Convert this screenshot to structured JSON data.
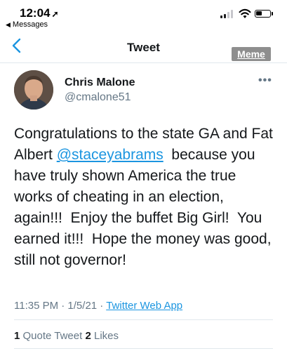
{
  "status_bar": {
    "time": "12:04",
    "back_app": "Messages"
  },
  "nav": {
    "title": "Tweet",
    "badge": "Meme"
  },
  "tweet": {
    "author_name": "Chris Malone",
    "author_handle": "@cmalone51",
    "text_before": "Congratulations to the state GA and Fat Albert ",
    "mention": "@staceyabrams",
    "text_after": "  because you have truly shown America the true works of cheating in an election, again!!!  Enjoy the buffet Big Girl!  You earned it!!!  Hope the money was good, still not governor!",
    "timestamp": "11:35 PM · 1/5/21 · ",
    "source": "Twitter Web App"
  },
  "stats": {
    "quote_count": "1",
    "quote_label": " Quote Tweet ",
    "like_count": "2",
    "like_label": " Likes"
  },
  "colors": {
    "link": "#1b95e0",
    "secondary_text": "#657786",
    "badge_bg": "#8e8e8e"
  },
  "icons": [
    "location-arrow-icon",
    "back-triangle-icon",
    "signal-icon",
    "wifi-icon",
    "battery-icon",
    "back-chevron-icon",
    "more-icon"
  ]
}
